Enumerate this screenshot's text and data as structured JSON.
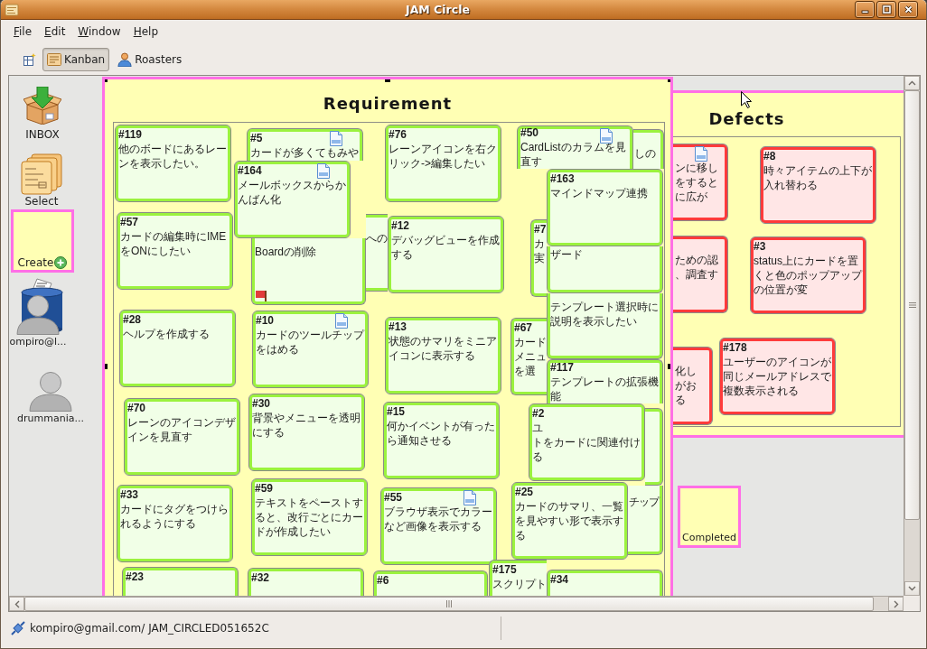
{
  "window": {
    "title": "JAM Circle"
  },
  "menu": [
    {
      "label": "File"
    },
    {
      "label": "Edit"
    },
    {
      "label": "Window"
    },
    {
      "label": "Help"
    }
  ],
  "toolbar": {
    "perspectives": [
      {
        "kind": "board",
        "label": "Kanban",
        "selected": true
      },
      {
        "kind": "people",
        "label": "Roasters",
        "selected": false
      }
    ]
  },
  "sidebar": {
    "items": [
      {
        "kind": "inbox",
        "label": "INBOX"
      },
      {
        "kind": "select",
        "label": "Select"
      },
      {
        "kind": "create",
        "label": "Create"
      },
      {
        "kind": "trash"
      },
      {
        "kind": "user",
        "label": "ompiro@l..."
      },
      {
        "kind": "user",
        "label": "drummania..."
      }
    ]
  },
  "board": {
    "lanes": [
      {
        "kind": "open",
        "title": "Requirement",
        "selected": true,
        "cards": [
          {
            "kind": "requirement",
            "number": "#119",
            "text": "他のボードにあるレーンを表示したい。",
            "has_file": false,
            "flagged": false
          },
          {
            "kind": "requirement",
            "number": "#5",
            "text": "カードが多くてもみや",
            "has_file": true,
            "flagged": false
          },
          {
            "kind": "requirement",
            "number": "#164",
            "text": "メールボックスからかんばん化",
            "has_file": true,
            "flagged": false
          },
          {
            "kind": "requirement",
            "number": "#76",
            "text": "レーンアイコンを右クリック->編集したい",
            "has_file": false,
            "flagged": false
          },
          {
            "kind": "requirement",
            "number": "#50",
            "text": "CardListのカラムを見直す",
            "has_file": true,
            "flagged": false
          },
          {
            "kind": "requirement",
            "lines": [
              "しの"
            ],
            "has_file": false,
            "flagged": false
          },
          {
            "kind": "requirement",
            "number": "#163",
            "text": "マインドマップ連携",
            "has_file": false,
            "flagged": false
          },
          {
            "kind": "requirement",
            "number": "#57",
            "text": "カードの編集時にIMEをONにしたい",
            "has_file": false,
            "flagged": false
          },
          {
            "kind": "requirement",
            "text": "Boardの削除",
            "has_file": false,
            "flagged": true
          },
          {
            "kind": "requirement",
            "lines": [
              "への"
            ],
            "has_file": false,
            "flagged": false
          },
          {
            "kind": "requirement",
            "number": "#12",
            "text": "デバッグビューを作成する",
            "has_file": false,
            "flagged": false
          },
          {
            "kind": "requirement",
            "number": "#7",
            "lines": [
              "カ",
              "実"
            ],
            "has_file": false,
            "flagged": false
          },
          {
            "kind": "requirement",
            "lines": [
              "ザード"
            ],
            "has_file": false,
            "flagged": false
          },
          {
            "kind": "requirement",
            "number": "#28",
            "text": "ヘルプを作成する",
            "has_file": false,
            "flagged": false
          },
          {
            "kind": "requirement",
            "number": "#10",
            "text": "カードのツールチップをはめる",
            "has_file": true,
            "flagged": false
          },
          {
            "kind": "requirement",
            "number": "#13",
            "text": "状態のサマリをミニアイコンに表示する",
            "has_file": false,
            "flagged": false
          },
          {
            "kind": "requirement",
            "number": "#67",
            "lines": [
              "カード",
              "メニュ",
              "を選"
            ],
            "has_file": false,
            "flagged": false
          },
          {
            "kind": "requirement",
            "text": "テンプレート選択時に説明を表示したい",
            "has_file": false,
            "flagged": false
          },
          {
            "kind": "requirement",
            "number": "#70",
            "text": "レーンのアイコンデザインを見直す",
            "has_file": false,
            "flagged": false
          },
          {
            "kind": "requirement",
            "number": "#30",
            "text": "背景やメニューを透明にする",
            "has_file": false,
            "flagged": false
          },
          {
            "kind": "requirement",
            "number": "#15",
            "text": "何かイベントが有ったら通知させる",
            "has_file": false,
            "flagged": false
          },
          {
            "kind": "requirement",
            "number": "#117",
            "text": "テンプレートの拡張機能",
            "has_file": false,
            "flagged": false
          },
          {
            "kind": "requirement",
            "number": "#2",
            "lines": [
              "ユ",
              "トをカードに関連付け",
              "る"
            ],
            "has_file": false,
            "flagged": false
          },
          {
            "kind": "requirement",
            "has_file": false,
            "flagged": false
          },
          {
            "kind": "requirement",
            "number": "#33",
            "text": "カードにタグをつけられるようにする",
            "has_file": false,
            "flagged": false
          },
          {
            "kind": "requirement",
            "number": "#59",
            "text": "テキストをペーストすると、改行ごとにカードが作成したい",
            "has_file": false,
            "flagged": false
          },
          {
            "kind": "requirement",
            "number": "#55",
            "text": "ブラウザ表示でカラーなど画像を表示する",
            "has_file": true,
            "flagged": false
          },
          {
            "kind": "requirement",
            "number": "#25",
            "text": "カードのサマリ、一覧を見やすい形で表示する",
            "has_file": false,
            "flagged": false
          },
          {
            "kind": "requirement",
            "lines": [
              "チップ"
            ],
            "has_file": false,
            "flagged": false
          },
          {
            "kind": "requirement",
            "number": "#23",
            "has_file": false,
            "flagged": false
          },
          {
            "kind": "requirement",
            "number": "#32",
            "has_file": false,
            "flagged": false
          },
          {
            "kind": "requirement",
            "number": "#6",
            "has_file": false,
            "flagged": false
          },
          {
            "kind": "requirement",
            "number": "#175",
            "lines": [
              "スクリプト"
            ],
            "has_file": false,
            "flagged": false
          },
          {
            "kind": "requirement",
            "number": "#34",
            "has_file": false,
            "flagged": false
          }
        ]
      },
      {
        "kind": "open",
        "title": "Defects",
        "selected": false,
        "cards": [
          {
            "kind": "defect",
            "lines": [
              "ンに移し",
              "をすると",
              "に広が"
            ],
            "has_file": true,
            "flagged": false
          },
          {
            "kind": "defect",
            "number": "#8",
            "text": "時々アイテムの上下が入れ替わる",
            "has_file": false,
            "flagged": false
          },
          {
            "kind": "defect",
            "lines": [
              "ための認",
              "、調査す"
            ],
            "has_file": false,
            "flagged": false
          },
          {
            "kind": "defect",
            "number": "#3",
            "text": "status上にカードを置くと色のポップアップの位置が変",
            "has_file": false,
            "flagged": false
          },
          {
            "kind": "defect",
            "lines": [
              "化し",
              "がお",
              "る"
            ],
            "has_file": false,
            "flagged": false
          },
          {
            "kind": "defect",
            "number": "#178",
            "text": "ユーザーのアイコンが同じメールアドレスで複数表示される",
            "has_file": false,
            "flagged": false
          }
        ]
      },
      {
        "kind": "iconified",
        "title": "Completed",
        "selected": false
      }
    ]
  },
  "status_bar": {
    "text": "kompiro@gmail.com/ JAM_CIRCLED051652C"
  }
}
